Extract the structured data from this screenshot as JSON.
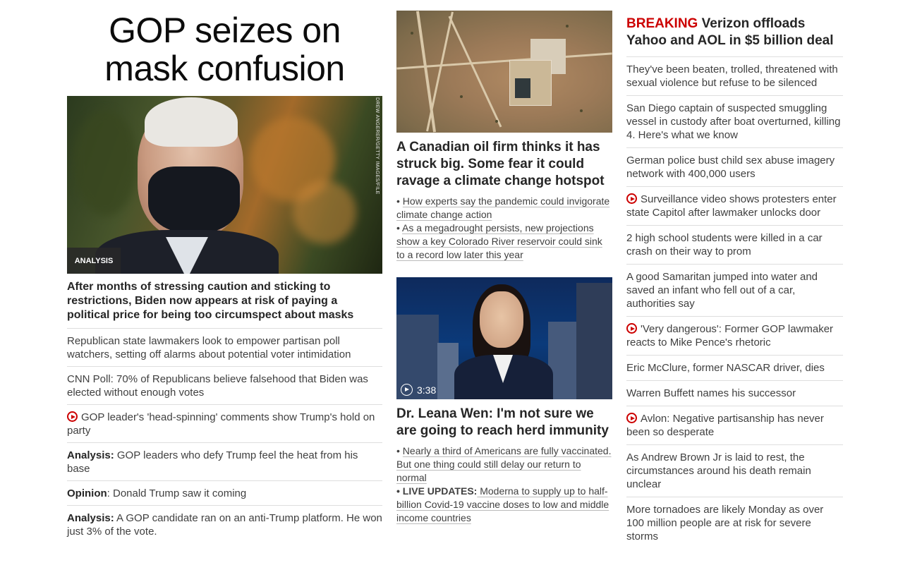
{
  "col1": {
    "banner": "GOP seizes on mask confusion",
    "image_credit": "DREW ANGERER/GETTY IMAGES/FILE",
    "image_tag": "ANALYSIS",
    "lead_headline": "After months of stressing caution and sticking to restrictions, Biden now appears at risk of paying a political price for being too circumspect about masks",
    "items": [
      {
        "prefix": "",
        "text": "Republican state lawmakers look to empower partisan poll watchers, setting off alarms about potential voter intimidation"
      },
      {
        "prefix": "",
        "text": "CNN Poll: 70% of Republicans believe falsehood that Biden was elected without enough votes"
      },
      {
        "prefix": "",
        "text": "GOP leader's 'head-spinning' comments show Trump's hold on party",
        "video": true
      },
      {
        "prefix": "Analysis:",
        "text": " GOP leaders who defy Trump feel the heat from his base"
      },
      {
        "prefix": "Opinion",
        "text": ": Donald Trump saw it coming"
      },
      {
        "prefix": "Analysis:",
        "text": " A GOP candidate ran on an anti-Trump platform. He won just 3% of the vote."
      }
    ]
  },
  "col2": {
    "oil_headline": "A Canadian oil firm thinks it has struck big. Some fear it could ravage a climate change hotspot",
    "oil_bullets": [
      "How experts say the pandemic could invigorate climate change action",
      "As a megadrought persists, new projections show a key Colorado River reservoir could sink to a record low later this year"
    ],
    "video_duration": "3:38",
    "wen_headline": "Dr. Leana Wen: I'm not sure we are going to reach herd immunity",
    "wen_bullets": [
      {
        "label": "",
        "text": "Nearly a third of Americans are fully vaccinated. But one thing could still delay our return to normal"
      },
      {
        "label": "LIVE UPDATES:",
        "text": " Moderna to supply up to half-billion Covid-19 vaccine doses to low and middle income countries"
      }
    ]
  },
  "col3": {
    "breaking_label": "BREAKING",
    "breaking_text": " Verizon offloads Yahoo and AOL in $5 billion deal",
    "items": [
      {
        "text": "They've been beaten, trolled, threatened with sexual violence but refuse to be silenced"
      },
      {
        "text": "San Diego captain of suspected smuggling vessel in custody after boat overturned, killing 4. Here's what we know"
      },
      {
        "text": "German police bust child sex abuse imagery network with 400,000 users"
      },
      {
        "text": "Surveillance video shows protesters enter state Capitol after lawmaker unlocks door",
        "video": true
      },
      {
        "text": "2 high school students were killed in a car crash on their way to prom"
      },
      {
        "text": "A good Samaritan jumped into water and saved an infant who fell out of a car, authorities say"
      },
      {
        "text": "'Very dangerous': Former GOP lawmaker reacts to Mike Pence's rhetoric",
        "video": true
      },
      {
        "text": "Eric McClure, former NASCAR driver, dies"
      },
      {
        "text": "Warren Buffett names his successor"
      },
      {
        "text": "Avlon: Negative partisanship has never been so desperate",
        "video": true
      },
      {
        "text": "As Andrew Brown Jr is laid to rest, the circumstances around his death remain unclear"
      },
      {
        "text": "More tornadoes are likely Monday as over 100 million people are at risk for severe storms"
      }
    ]
  },
  "colors": {
    "breaking": "#cc0000",
    "text": "#262626",
    "divider": "#dedede"
  }
}
